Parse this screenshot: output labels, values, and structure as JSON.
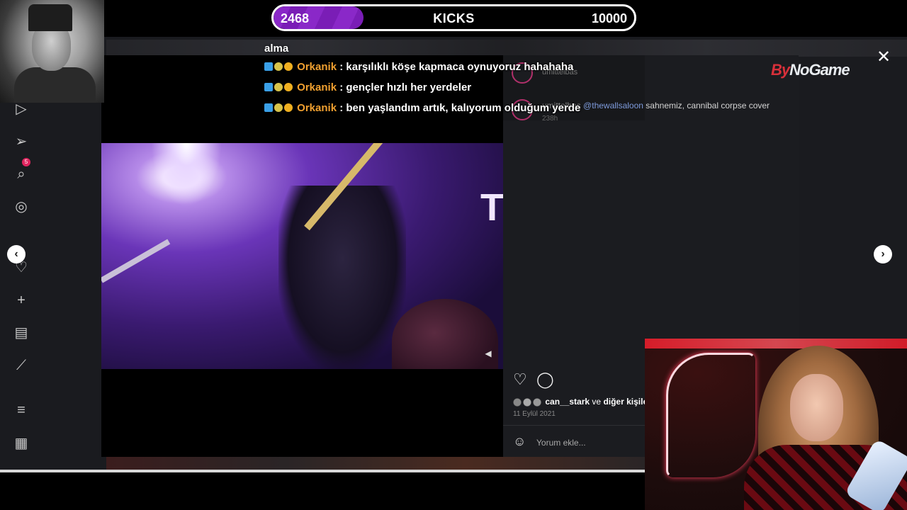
{
  "goal": {
    "current": "2468",
    "label": "KICKS",
    "target": "10000",
    "progress": 0.2468,
    "fill_color": "#8a28c8"
  },
  "sidebar": {
    "items": [
      {
        "icon": "home-icon"
      },
      {
        "icon": "reels-icon"
      },
      {
        "icon": "direct-message-icon",
        "badge": "5"
      },
      {
        "icon": "search-icon"
      },
      {
        "icon": "explore-icon"
      },
      {
        "icon": "heart-icon"
      },
      {
        "icon": "create-icon"
      },
      {
        "icon": "dashboard-icon"
      },
      {
        "icon": "threads-icon"
      },
      {
        "icon": "menu-icon"
      },
      {
        "icon": "apps-icon"
      }
    ]
  },
  "chat": {
    "top_text": "alma",
    "messages": [
      {
        "user": "Orkanik",
        "text": ": karşılıklı köşe kapmaca oynuyoruz hahahaha"
      },
      {
        "user": "Orkanik",
        "text": ": gençler hızlı her yerdeler"
      },
      {
        "user": "Orkanik",
        "text": ": ben yaşlandım artık, kalıyorum olduğum yerde"
      }
    ],
    "user_color": "#f0a030"
  },
  "post": {
    "username_top": "umittelbas",
    "caption": {
      "username": "umittelbas",
      "mention": "@thewallsaloon",
      "text": "sahnemiz, cannibal corpse cover",
      "time": "238h"
    },
    "brand": {
      "first": "By",
      "second": "NoGame"
    },
    "likes": {
      "first_user": "can__stark",
      "connector": "ve",
      "others": "diğer kişiler b"
    },
    "date": "11 Eylül 2021",
    "comment_placeholder": "Yorum ekle..."
  },
  "controls": {
    "close": "✕",
    "prev": "‹",
    "next": "›"
  }
}
